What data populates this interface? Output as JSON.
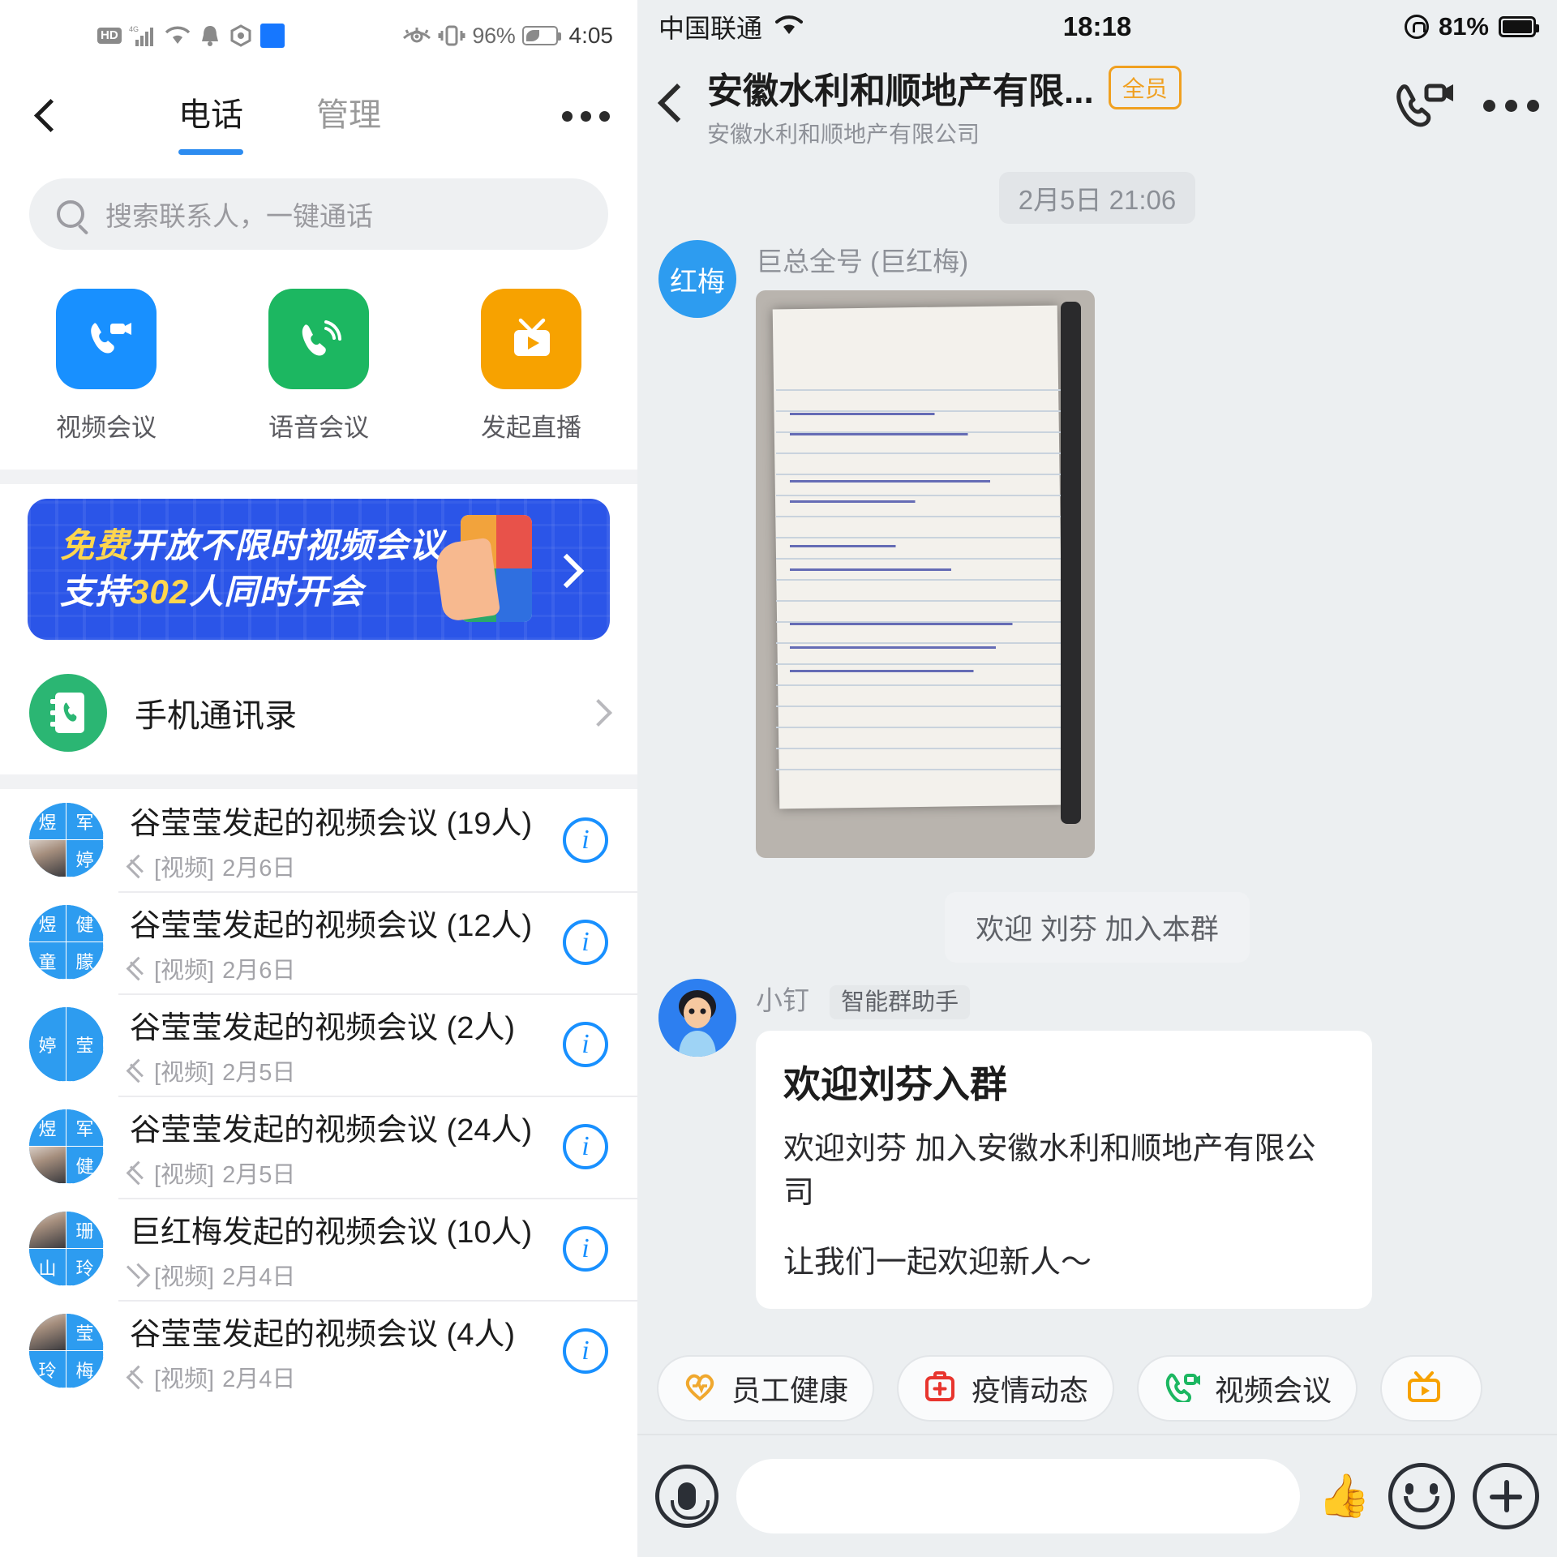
{
  "left": {
    "statusbar": {
      "hd_label": "HD",
      "signal_icon": "signal-bars-icon",
      "wifi_icon": "wifi-icon",
      "bell_icon": "bell-icon",
      "shield_icon": "shield-icon",
      "app_icon": "blue-app-icon",
      "eye_icon": "eye-protect-icon",
      "vibrate_icon": "vibrate-icon",
      "battery_percent": "96%",
      "battery_icon": "battery-icon",
      "time": "4:05"
    },
    "nav": {
      "back_icon": "back-chevron-icon",
      "more_icon": "more-dots-icon",
      "tabs": [
        {
          "label": "电话",
          "active": true
        },
        {
          "label": "管理",
          "active": false
        }
      ]
    },
    "search": {
      "icon": "search-icon",
      "placeholder": "搜索联系人，一键通话"
    },
    "quick_actions": [
      {
        "label": "视频会议",
        "color": "#1890ff",
        "icon": "video-call-icon"
      },
      {
        "label": "语音会议",
        "color": "#1cb761",
        "icon": "voice-call-icon"
      },
      {
        "label": "发起直播",
        "color": "#f7a200",
        "icon": "live-stream-icon"
      }
    ],
    "banner": {
      "line1_highlight": "免费",
      "line1_rest": "开放不限时视频会议",
      "line2_prefix": "支持",
      "line2_highlight": "302",
      "line2_rest": "人同时开会",
      "arrow_icon": "chevron-right-icon"
    },
    "contacts_entry": {
      "label": "手机通讯录",
      "icon": "phonebook-icon",
      "chevron_icon": "chevron-right-icon"
    },
    "call_list": [
      {
        "title": "谷莹莹发起的视频会议 (19人)",
        "direction": "out",
        "type_tag": "[视频]",
        "date": "2月6日",
        "avatar": [
          "煜",
          "军",
          "photo",
          "婷"
        ],
        "info_icon": "info-icon"
      },
      {
        "title": "谷莹莹发起的视频会议 (12人)",
        "direction": "out",
        "type_tag": "[视频]",
        "date": "2月6日",
        "avatar": [
          "煜",
          "健",
          "童",
          "朦"
        ],
        "info_icon": "info-icon"
      },
      {
        "title": "谷莹莹发起的视频会议 (2人)",
        "direction": "out",
        "type_tag": "[视频]",
        "date": "2月5日",
        "avatar": [
          "婷",
          "莹"
        ],
        "info_icon": "info-icon"
      },
      {
        "title": "谷莹莹发起的视频会议 (24人)",
        "direction": "out",
        "type_tag": "[视频]",
        "date": "2月5日",
        "avatar": [
          "煜",
          "军",
          "photo",
          "健"
        ],
        "info_icon": "info-icon"
      },
      {
        "title": "巨红梅发起的视频会议 (10人)",
        "direction": "in",
        "type_tag": "[视频]",
        "date": "2月4日",
        "avatar": [
          "photo",
          "珊",
          "山",
          "玲"
        ],
        "info_icon": "info-icon"
      },
      {
        "title": "谷莹莹发起的视频会议 (4人)",
        "direction": "out",
        "type_tag": "[视频]",
        "date": "2月4日",
        "avatar": [
          "photo",
          "莹",
          "玲",
          "梅"
        ],
        "info_icon": "info-icon"
      }
    ]
  },
  "right": {
    "statusbar": {
      "carrier": "中国联通",
      "wifi_icon": "wifi-icon",
      "time": "18:18",
      "lock_icon": "rotation-lock-icon",
      "battery_percent": "81%",
      "battery_icon": "battery-icon"
    },
    "nav": {
      "back_icon": "back-chevron-icon",
      "title": "安徽水利和顺地产有限...",
      "badge": "全员",
      "subtitle": "安徽水利和顺地产有限公司",
      "video_call_icon": "video-call-icon",
      "more_icon": "more-dots-icon"
    },
    "chat": {
      "timestamp": "2月5日 21:06",
      "photo_message": {
        "sender": "巨总全号 (巨红梅)",
        "avatar_text": "红梅",
        "image_alt": "handwritten-notebook-photo"
      },
      "system_message": "欢迎 刘芬 加入本群",
      "bot_message": {
        "sender": "小钉",
        "tag": "智能群助手",
        "avatar_alt": "bot-avatar",
        "card_title": "欢迎刘芬入群",
        "card_body": "欢迎刘芬 加入安徽水利和顺地产有限公司",
        "card_footer": "让我们一起欢迎新人～"
      }
    },
    "chips": [
      {
        "label": "员工健康",
        "icon": "heart-icon",
        "color": "#f0a82e"
      },
      {
        "label": "疫情动态",
        "icon": "medical-kit-icon",
        "color": "#e8352e"
      },
      {
        "label": "视频会议",
        "icon": "video-call-icon",
        "color": "#1cb761"
      },
      {
        "label": "",
        "icon": "video-player-icon",
        "color": "#f7a200"
      }
    ],
    "input": {
      "mic_icon": "microphone-icon",
      "field_value": "",
      "thumb_icon": "thumbs-up-icon",
      "emoji_icon": "emoji-icon",
      "plus_icon": "plus-icon"
    }
  }
}
